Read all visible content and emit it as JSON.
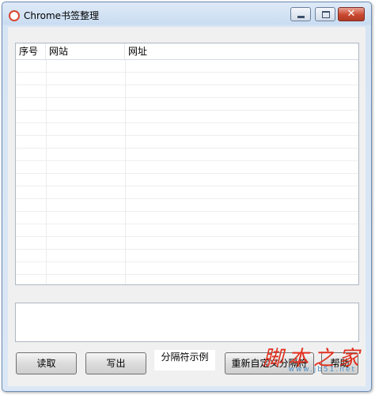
{
  "window": {
    "title": "Chrome书签整理",
    "controls": {
      "minimize": "minimize-icon",
      "maximize": "maximize-icon",
      "close": "close-icon"
    },
    "close_glyph": "✕"
  },
  "list": {
    "columns": [
      "序号",
      "网站",
      "网址"
    ],
    "rows": []
  },
  "textbox": {
    "value": ""
  },
  "buttons": {
    "read": "读取",
    "write": "写出",
    "separator_example": "分隔符示例",
    "redefine_separator": "重新自定义分隔符",
    "help": "帮助"
  },
  "watermark": {
    "text": "脚本之家",
    "url": "www.jb51.net"
  },
  "colors": {
    "close_button": "#c9482f",
    "watermark": "#e0301e",
    "border": "#6f8fb8"
  }
}
